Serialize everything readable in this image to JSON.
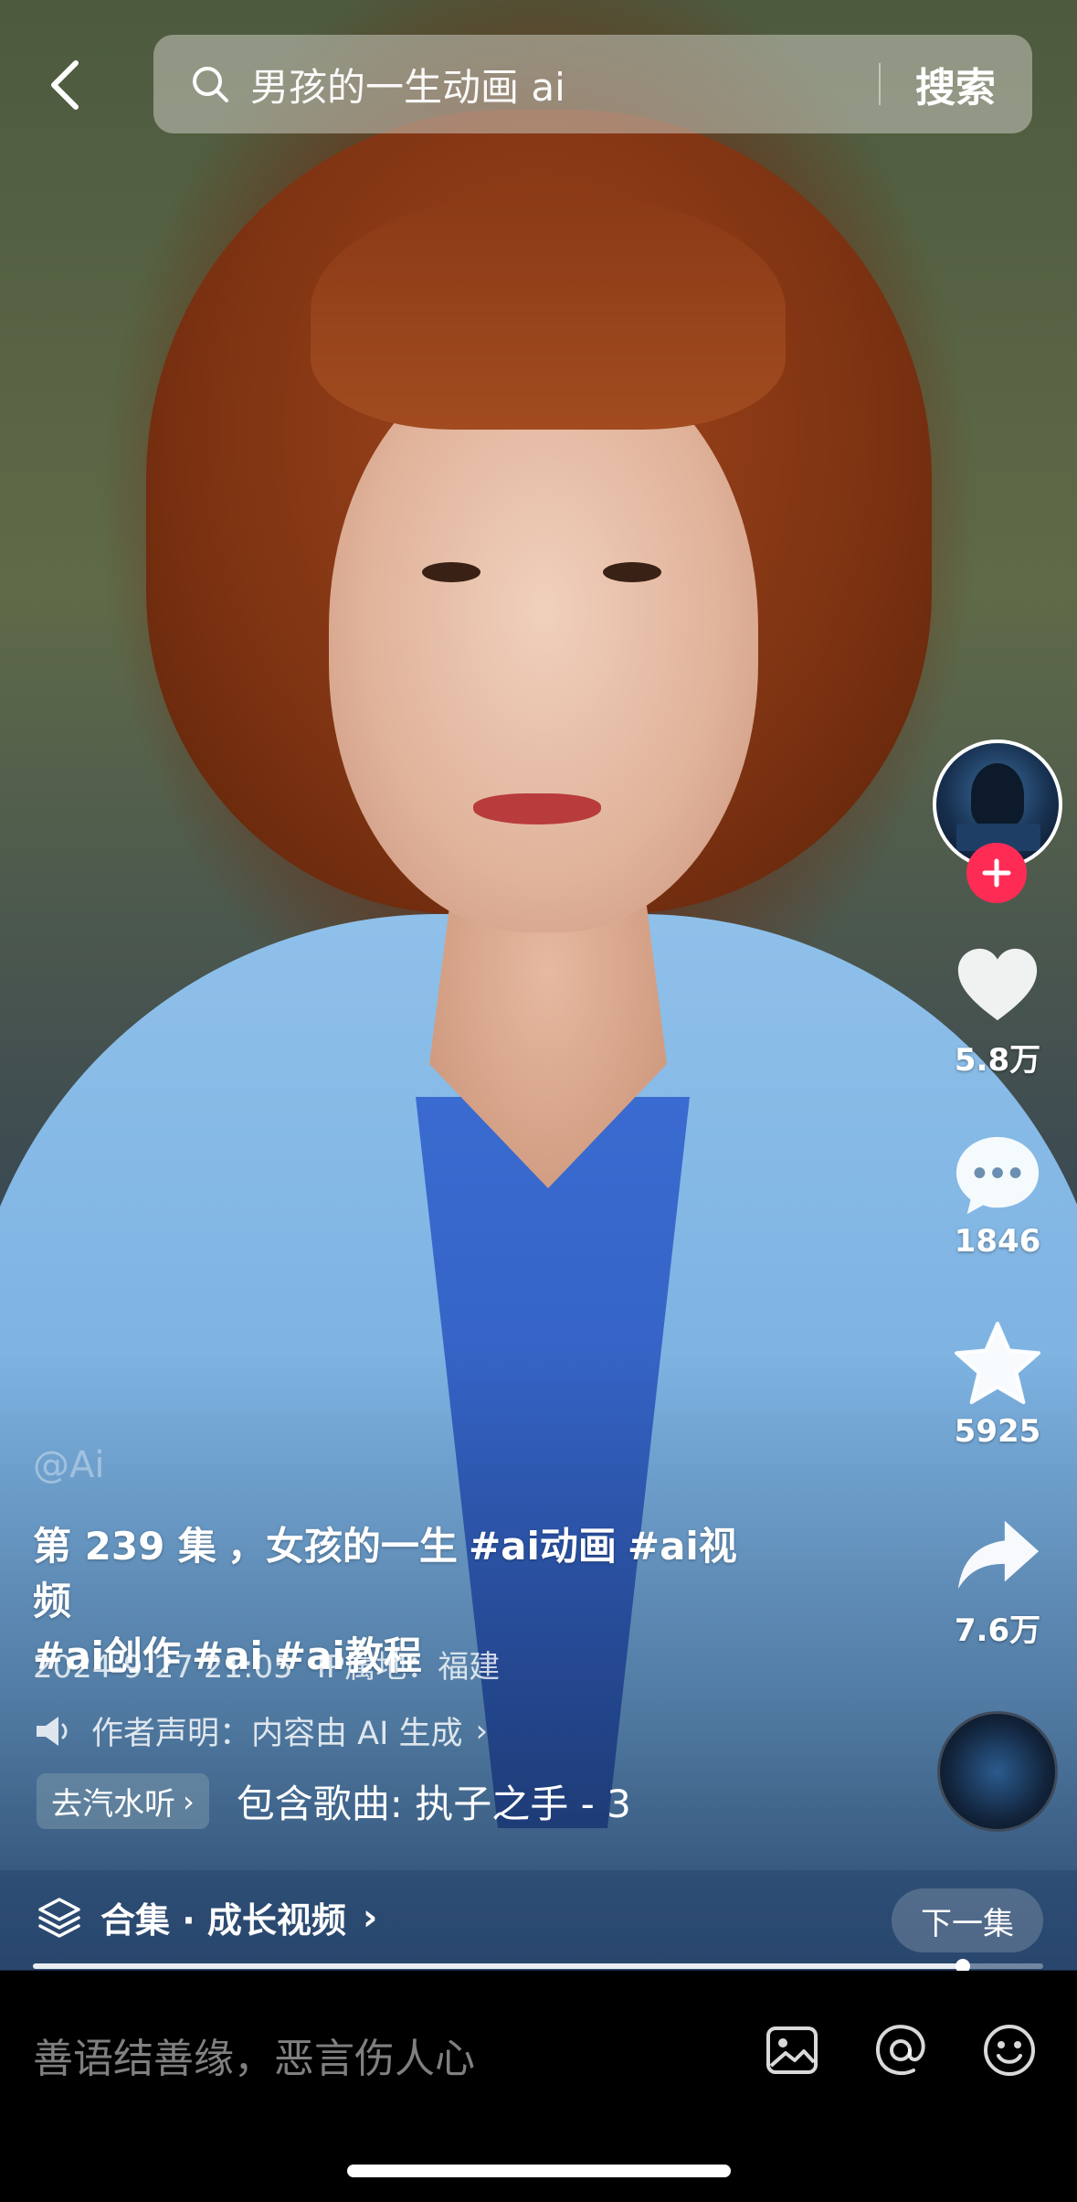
{
  "search": {
    "query": "男孩的一生动画 ai",
    "button_label": "搜索"
  },
  "rail": {
    "like_count": "5.8万",
    "comment_count": "1846",
    "favorite_count": "5925",
    "share_count": "7.6万"
  },
  "post": {
    "watermark": "@Ai",
    "caption_lines": [
      [
        "第 239 集",
        "，女孩的一生",
        "#ai动画",
        "#ai视频"
      ],
      [
        "#ai创作",
        "#ai",
        "#ai教程"
      ]
    ],
    "date": "2024-9-27 21:05",
    "ip_location": "IP属地：福建",
    "declaration": "作者声明：内容由 AI 生成",
    "music_chip": "去汽水听",
    "song": "包含歌曲: 执子之手 - 3"
  },
  "collection": {
    "title": "合集 · 成长视频",
    "next_label": "下一集",
    "progress": 0.92
  },
  "comment": {
    "placeholder": "善语结善缘，恶言伤人心"
  },
  "colors": {
    "follow_accent": "#fe2c55"
  },
  "icons": [
    "back-icon",
    "search-icon",
    "plus-icon",
    "heart-icon",
    "comment-icon",
    "star-icon",
    "share-icon",
    "speaker-icon",
    "layers-icon",
    "image-icon",
    "at-icon",
    "emoji-icon"
  ]
}
